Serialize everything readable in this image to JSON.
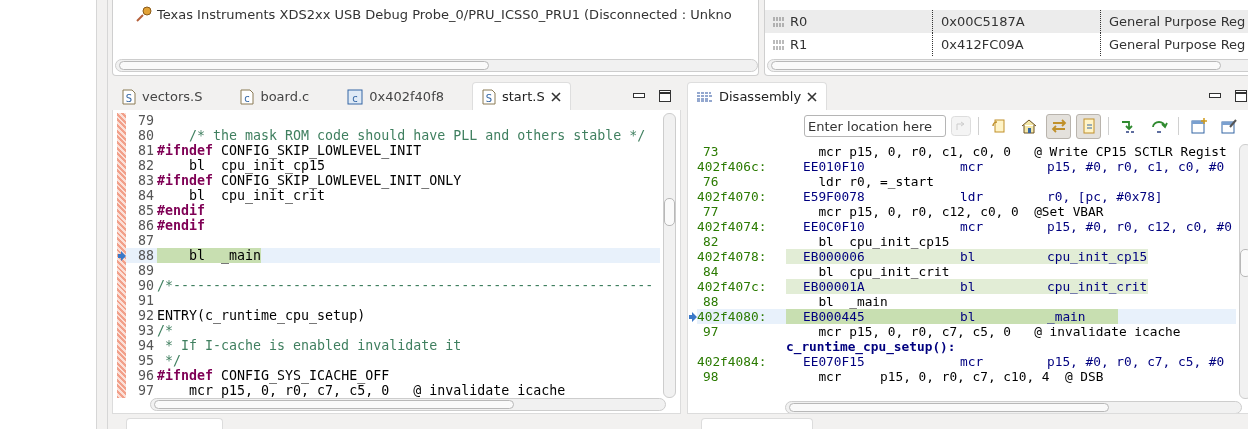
{
  "debug_view": {
    "target": "Texas Instruments XDS2xx USB Debug Probe_0/PRU_ICSS0_PRU1 (Disconnected : Unkno"
  },
  "registers": {
    "rows": [
      {
        "name": "R0",
        "value": "0x00C5187A",
        "description": "General Purpose Reg"
      },
      {
        "name": "R1",
        "value": "0x412FC09A",
        "description": "General Purpose Reg"
      }
    ]
  },
  "editor": {
    "tabs": [
      {
        "label": "vectors.S",
        "kind": "file",
        "icon_text": "S",
        "selected": false
      },
      {
        "label": "board.c",
        "kind": "file",
        "icon_text": "c",
        "selected": false
      },
      {
        "label": "0x402f40f8",
        "kind": "address",
        "icon_text": "c",
        "selected": false
      },
      {
        "label": "start.S",
        "kind": "file",
        "icon_text": "S",
        "selected": true
      }
    ],
    "lines": [
      {
        "num": "79",
        "current": false
      },
      {
        "num": "80",
        "current": false,
        "tokens": [
          {
            "kind": "comment",
            "text": "    /* the mask ROM code should have PLL and others stable */"
          }
        ]
      },
      {
        "num": "81",
        "current": false,
        "tokens": [
          {
            "kind": "keyword",
            "text": "#ifndef"
          },
          {
            "kind": "plain",
            "text": " CONFIG_SKIP_LOWLEVEL_INIT"
          }
        ]
      },
      {
        "num": "82",
        "current": false,
        "tokens": [
          {
            "kind": "plain",
            "text": "    bl  cpu_init_cp15"
          }
        ]
      },
      {
        "num": "83",
        "current": false,
        "tokens": [
          {
            "kind": "keyword",
            "text": "#ifndef"
          },
          {
            "kind": "plain",
            "text": " CONFIG_SKIP_LOWLEVEL_INIT_ONLY"
          }
        ]
      },
      {
        "num": "84",
        "current": false,
        "tokens": [
          {
            "kind": "plain",
            "text": "    bl  cpu_init_crit"
          }
        ]
      },
      {
        "num": "85",
        "current": false,
        "tokens": [
          {
            "kind": "keyword",
            "text": "#endif"
          }
        ]
      },
      {
        "num": "86",
        "current": false,
        "tokens": [
          {
            "kind": "keyword",
            "text": "#endif"
          }
        ]
      },
      {
        "num": "87",
        "current": false
      },
      {
        "num": "88",
        "current": true,
        "tokens": [
          {
            "kind": "plain",
            "text": "    bl  _main"
          }
        ]
      },
      {
        "num": "89",
        "current": false
      },
      {
        "num": "90",
        "current": false,
        "tokens": [
          {
            "kind": "comment",
            "text": "/*------------------------------------------------------------"
          }
        ]
      },
      {
        "num": "91",
        "current": false
      },
      {
        "num": "92",
        "current": false,
        "tokens": [
          {
            "kind": "plain",
            "text": "ENTRY(c_runtime_cpu_setup)"
          }
        ]
      },
      {
        "num": "93",
        "current": false,
        "tokens": [
          {
            "kind": "comment",
            "text": "/*"
          }
        ]
      },
      {
        "num": "94",
        "current": false,
        "tokens": [
          {
            "kind": "comment",
            "text": " * If I-cache is enabled invalidate it"
          }
        ]
      },
      {
        "num": "95",
        "current": false,
        "tokens": [
          {
            "kind": "comment",
            "text": " */"
          }
        ]
      },
      {
        "num": "96",
        "current": false,
        "tokens": [
          {
            "kind": "keyword",
            "text": "#ifndef"
          },
          {
            "kind": "plain",
            "text": " CONFIG_SYS_ICACHE_OFF"
          }
        ]
      },
      {
        "num": "97",
        "current": false,
        "tokens": [
          {
            "kind": "plain",
            "text": "    mcr p15, 0, r0, c7, c5, 0   @ invalidate icache"
          }
        ]
      }
    ]
  },
  "disassembly": {
    "title": "Disassembly",
    "location": {
      "placeholder": "Enter location here"
    },
    "toolbar": [
      {
        "selected": false
      },
      {
        "selected": false
      },
      {
        "selected": true
      },
      {
        "selected": true
      },
      {
        "selected": false
      },
      {
        "selected": false
      },
      {
        "selected": false
      },
      {
        "selected": false
      }
    ],
    "rows": [
      {
        "kind": "source",
        "num": "73",
        "text": "  mcr p15, 0, r0, c1, c0, 0   @ Write CP15 SCTLR Regist"
      },
      {
        "kind": "instr",
        "address": "402f406c:",
        "opcode": "EE010F10",
        "mnemonic": "mcr",
        "operands": "p15, #0, r0, c1, c0, #0",
        "highlighted": false,
        "current": false
      },
      {
        "kind": "source",
        "num": "76",
        "text": "  ldr r0, =_start"
      },
      {
        "kind": "instr",
        "address": "402f4070:",
        "opcode": "E59F0078",
        "mnemonic": "ldr",
        "operands": "r0, [pc, #0x78]",
        "highlighted": false,
        "current": false
      },
      {
        "kind": "source",
        "num": "77",
        "text": "  mcr p15, 0, r0, c12, c0, 0  @Set VBAR"
      },
      {
        "kind": "instr",
        "address": "402f4074:",
        "opcode": "EE0C0F10",
        "mnemonic": "mcr",
        "operands": "p15, #0, r0, c12, c0, #0",
        "highlighted": false,
        "current": false
      },
      {
        "kind": "source",
        "num": "82",
        "text": "  bl  cpu_init_cp15"
      },
      {
        "kind": "instr",
        "address": "402f4078:",
        "opcode": "EB000006",
        "mnemonic": "bl",
        "operands": "cpu_init_cp15",
        "highlighted": true,
        "current": false
      },
      {
        "kind": "source",
        "num": "84",
        "text": "  bl  cpu_init_crit"
      },
      {
        "kind": "instr",
        "address": "402f407c:",
        "opcode": "EB00001A",
        "mnemonic": "bl",
        "operands": "cpu_init_crit",
        "highlighted": true,
        "current": false
      },
      {
        "kind": "source",
        "num": "88",
        "text": "  bl  _main"
      },
      {
        "kind": "instr",
        "address": "402f4080:",
        "opcode": "EB000445",
        "mnemonic": "bl",
        "operands": "_main",
        "highlighted": true,
        "current": true
      },
      {
        "kind": "source",
        "num": "97",
        "text": "  mcr p15, 0, r0, c7, c5, 0   @ invalidate icache"
      },
      {
        "kind": "label",
        "text": "c_runtime_cpu_setup():"
      },
      {
        "kind": "instr",
        "address": "402f4084:",
        "opcode": "EE070F15",
        "mnemonic": "mcr",
        "operands": "p15, #0, r0, c7, c5, #0",
        "highlighted": false,
        "current": false
      },
      {
        "kind": "source",
        "num": "98",
        "text": "  mcr     p15, 0, r0, c7, c10, 4  @ DSB"
      }
    ]
  }
}
